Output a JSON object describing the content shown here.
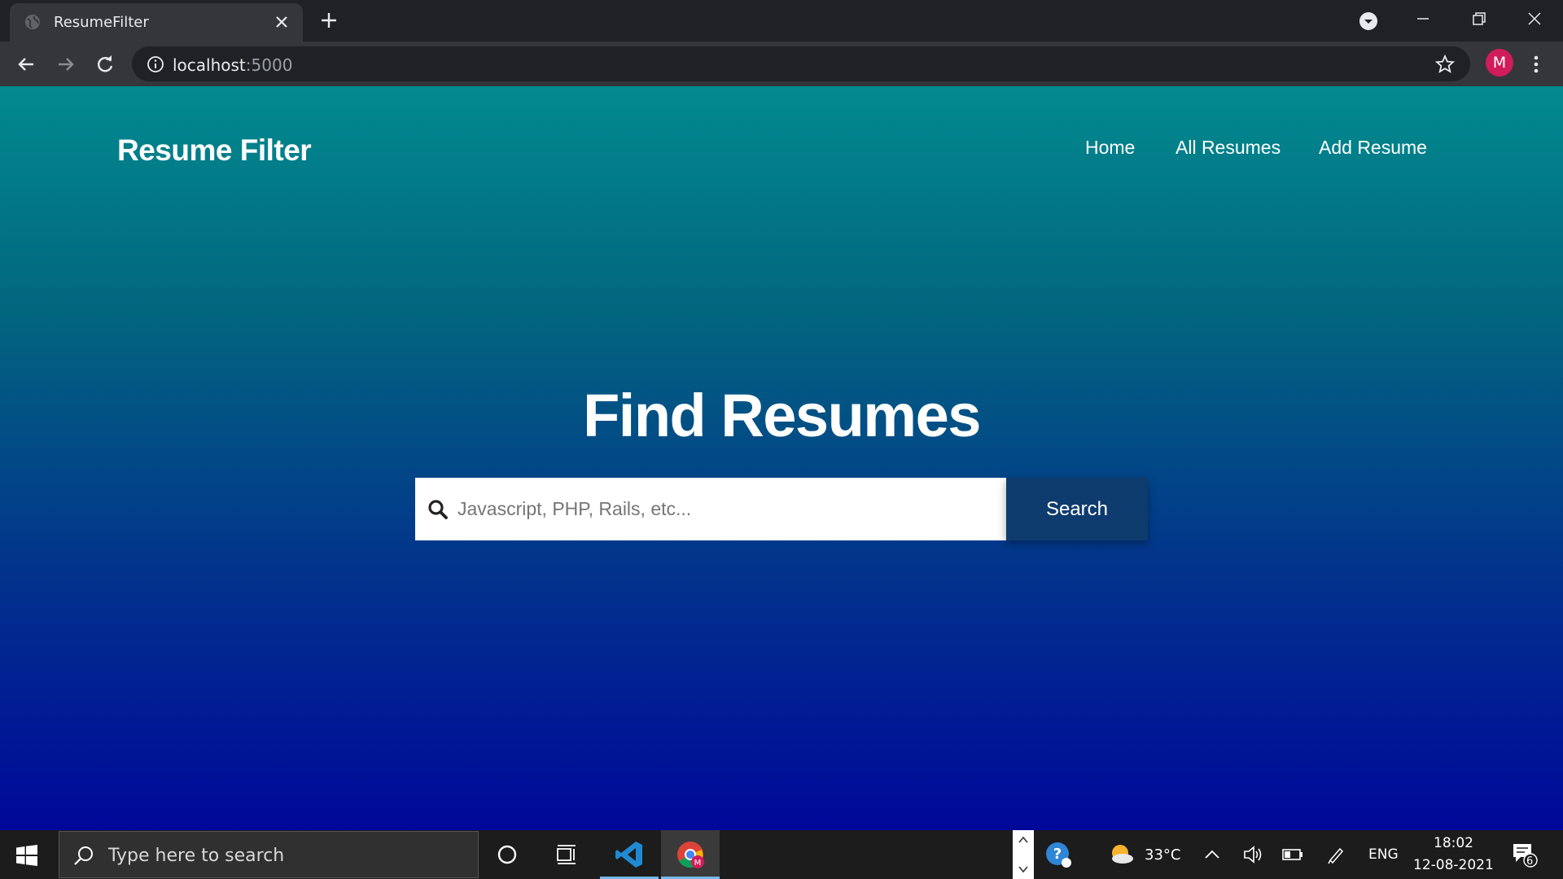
{
  "browser": {
    "tab_title": "ResumeFilter",
    "url_host": "localhost",
    "url_port": ":5000",
    "profile_initial": "M"
  },
  "site": {
    "brand": "Resume Filter",
    "nav": [
      "Home",
      "All Resumes",
      "Add Resume"
    ],
    "hero_title": "Find Resumes",
    "search_placeholder": "Javascript, PHP, Rails, etc...",
    "search_button": "Search"
  },
  "taskbar": {
    "search_placeholder": "Type here to search",
    "temperature": "33°C",
    "language": "ENG",
    "time": "18:02",
    "date": "12-08-2021",
    "notification_count": "6"
  },
  "colors": {
    "gradient_top": "#028a8f",
    "gradient_bottom": "#00089a",
    "search_button_bg": "#0e3b6e",
    "avatar_bg": "#d01c5a"
  }
}
